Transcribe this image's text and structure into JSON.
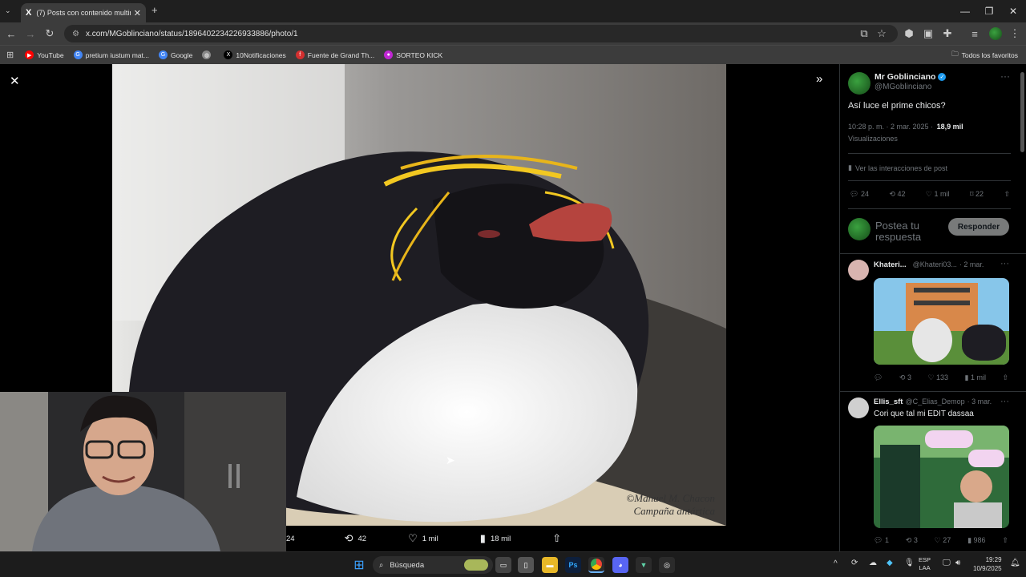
{
  "browser": {
    "tab_title": "(7) Posts con contenido multim",
    "tab_logo": "X",
    "new_tab": "+",
    "url": "x.com/MGoblinciano/status/1896402234226933886/photo/1"
  },
  "bookmarks": [
    {
      "label": "YouTube",
      "color": "#ff0000",
      "glyph": "▶"
    },
    {
      "label": "pretium iustum mat...",
      "color": "#4285f4",
      "glyph": "G"
    },
    {
      "label": "Google",
      "color": "#4285f4",
      "glyph": "G"
    },
    {
      "label": "",
      "color": "#888888",
      "glyph": "◍"
    },
    {
      "label": "10Notificaciones",
      "color": "#000000",
      "glyph": "X"
    },
    {
      "label": "Fuente de Grand Th...",
      "color": "#d32f2f",
      "glyph": "f"
    },
    {
      "label": "SORTEO KICK",
      "color": "#c026d3",
      "glyph": "●"
    }
  ],
  "bookmarks_all": "Todos los favoritos",
  "photo": {
    "watermark_line1": "©Manuel M. Chacon",
    "watermark_line2": "Campaña antártica"
  },
  "photo_bar": {
    "replies": "24",
    "reposts": "42",
    "likes": "1 mil",
    "views": "18 mil"
  },
  "post": {
    "author": "Mr Goblinciano",
    "handle": "@MGoblinciano",
    "text": "Así luce el prime chicos?",
    "time": "10:28 p. m. · 2 mar. 2025 ·",
    "views_count": "18,9 mil",
    "views_label": "Visualizaciones",
    "interactions": "Ver las interacciones de post",
    "replies": "24",
    "reposts": "42",
    "likes": "1 mil",
    "bookmarks": "22",
    "reply_placeholder": "Postea tu respuesta",
    "reply_button": "Responder"
  },
  "replies": [
    {
      "name": "Khateri...",
      "handle": "@Khateri03...",
      "date": "· 2 mar.",
      "text": "",
      "comments": "",
      "reposts": "3",
      "likes": "133",
      "views": "1 mil"
    },
    {
      "name": "Ellis_sft",
      "handle": "@C_Elias_Demop",
      "date": "· 3 mar.",
      "text": "Cori que tal mi EDIT dassaa",
      "comments": "1",
      "reposts": "3",
      "likes": "27",
      "views": "986"
    }
  ],
  "taskbar": {
    "search": "Búsqueda",
    "lang1": "ESP",
    "lang2": "LAA",
    "time": "19:29",
    "date": "10/9/2025"
  }
}
